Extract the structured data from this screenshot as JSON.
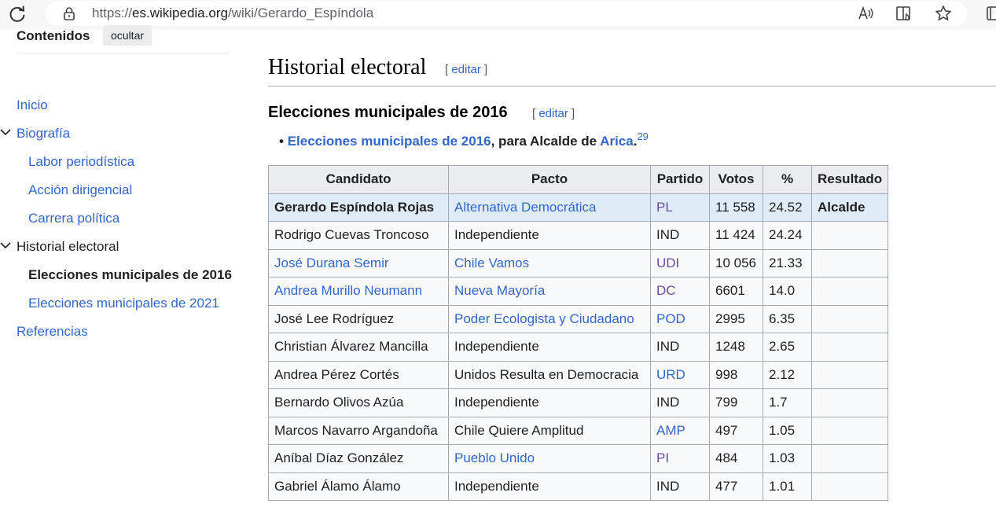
{
  "browser": {
    "url_prefix": "https://",
    "url_host": "es.wikipedia.org",
    "url_path": "/wiki/Gerardo_Espíndola"
  },
  "toc": {
    "title": "Contenidos",
    "hide_label": "ocultar",
    "items": [
      {
        "label": "Inicio"
      },
      {
        "label": "Biografía"
      },
      {
        "label": "Labor periodística"
      },
      {
        "label": "Acción dirigencial"
      },
      {
        "label": "Carrera política"
      },
      {
        "label": "Historial electoral"
      },
      {
        "label": "Elecciones municipales de 2016"
      },
      {
        "label": "Elecciones municipales de 2021"
      },
      {
        "label": "Referencias"
      }
    ]
  },
  "article": {
    "section_title": "Historial electoral",
    "subsection_title": "Elecciones municipales de 2016",
    "edit_label": "editar",
    "bullet": {
      "link1": "Elecciones municipales de 2016",
      "mid": ", para Alcalde de ",
      "link2": "Arica",
      "end": ".",
      "ref": "29"
    }
  },
  "table": {
    "headers": [
      "Candidato",
      "Pacto",
      "Partido",
      "Votos",
      "%",
      "Resultado"
    ],
    "rows": [
      {
        "candidato": "Gerardo Espíndola Rojas",
        "pacto": "Alternativa Democrática",
        "partido": "PL",
        "votos": "11 558",
        "pct": "24.52",
        "resultado": "Alcalde"
      },
      {
        "candidato": "Rodrigo Cuevas Troncoso",
        "pacto": "Independiente",
        "partido": "IND",
        "votos": "11 424",
        "pct": "24.24",
        "resultado": ""
      },
      {
        "candidato": "José Durana Semir",
        "pacto": "Chile Vamos",
        "partido": "UDI",
        "votos": "10 056",
        "pct": "21.33",
        "resultado": ""
      },
      {
        "candidato": "Andrea Murillo Neumann",
        "pacto": "Nueva Mayoría",
        "partido": "DC",
        "votos": "6601",
        "pct": "14.0",
        "resultado": ""
      },
      {
        "candidato": "José Lee Rodríguez",
        "pacto": "Poder Ecologista y Ciudadano",
        "partido": "POD",
        "votos": "2995",
        "pct": "6.35",
        "resultado": ""
      },
      {
        "candidato": "Christian Álvarez Mancilla",
        "pacto": "Independiente",
        "partido": "IND",
        "votos": "1248",
        "pct": "2.65",
        "resultado": ""
      },
      {
        "candidato": "Andrea Pérez Cortés",
        "pacto": "Unidos Resulta en Democracia",
        "partido": "URD",
        "votos": "998",
        "pct": "2.12",
        "resultado": ""
      },
      {
        "candidato": "Bernardo Olivos Azúa",
        "pacto": "Independiente",
        "partido": "IND",
        "votos": "799",
        "pct": "1.7",
        "resultado": ""
      },
      {
        "candidato": "Marcos Navarro Argandoña",
        "pacto": "Chile Quiere Amplitud",
        "partido": "AMP",
        "votos": "497",
        "pct": "1.05",
        "resultado": ""
      },
      {
        "candidato": "Aníbal Díaz González",
        "pacto": "Pueblo Unido",
        "partido": "PI",
        "votos": "484",
        "pct": "1.03",
        "resultado": ""
      },
      {
        "candidato": "Gabriel Álamo Álamo",
        "pacto": "Independiente",
        "partido": "IND",
        "votos": "477",
        "pct": "1.01",
        "resultado": ""
      }
    ]
  },
  "colors": {
    "link": "#3366cc",
    "visited_link": "#6b4ba1",
    "winner_row": "#e0ebf8",
    "header_bg": "#eaecf0"
  },
  "icons": [
    "reload-icon",
    "lock-icon",
    "read-aloud-icon",
    "immersive-reader-icon",
    "favorite-star-icon",
    "chevron-down-icon"
  ]
}
